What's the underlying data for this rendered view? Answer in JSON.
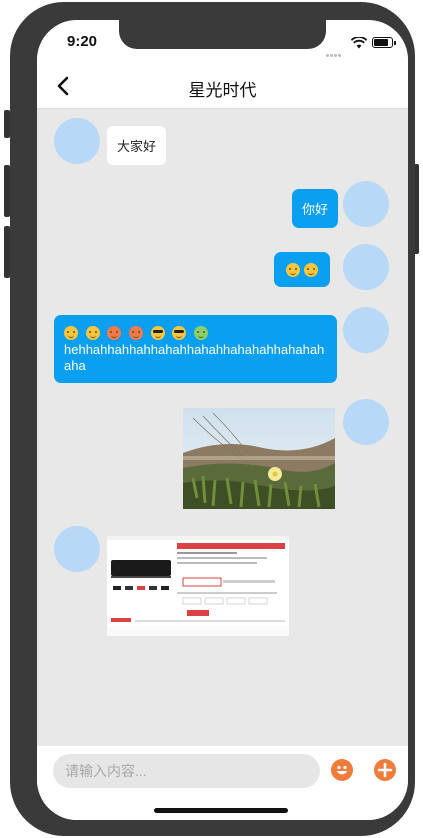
{
  "status_bar": {
    "time": "9:20"
  },
  "nav": {
    "title": "星光时代",
    "back_icon": "chevron-left-icon"
  },
  "messages": {
    "m1_text": "大家好",
    "m2_text": "你好",
    "m3_emojis": [
      "smiling-face-icon",
      "pleading-face-icon"
    ],
    "m4_emojis": [
      "smiling-face-icon",
      "pleading-face-icon",
      "star-struck-face-icon",
      "angry-face-icon",
      "sunglasses-face-icon",
      "sunglasses-face-icon",
      "nauseated-face-icon"
    ],
    "m4_text": "hehhahhahhahhahahhahahhahahahhahahahaha",
    "m5_image": "photo-flower-icon",
    "m6_image": "photo-product-screenshot-icon"
  },
  "input_bar": {
    "placeholder": "请输入内容...",
    "value": "",
    "emoji_icon": "emoji-button-icon",
    "plus_icon": "plus-button-icon"
  },
  "colors": {
    "bubble_blue": "#0a9ff0",
    "avatar": "#b7d8f7",
    "accent_orange": "#f07c3c",
    "chat_background": "#e8e8e8"
  }
}
